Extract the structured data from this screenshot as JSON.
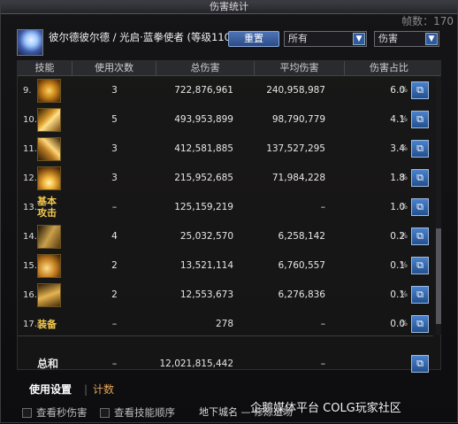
{
  "window": {
    "title": "伤害统计",
    "frame_label": "帧数：170"
  },
  "header": {
    "player_name": "彼尔德彼尔德 / 光启·蓝拳使者 (等级110)",
    "reset_label": "重置",
    "scope_value": "所有",
    "type_value": "伤害"
  },
  "table": {
    "columns": [
      "技能",
      "使用次数",
      "总伤害",
      "平均伤害",
      "伤害占比"
    ],
    "rows": [
      {
        "idx": "9.",
        "icon": "skill-icon",
        "label": "",
        "count": "3",
        "total": "722,876,961",
        "avg": "240,958,987",
        "pct": "6.0",
        "unit": "%"
      },
      {
        "idx": "10.",
        "icon": "skill-icon",
        "label": "",
        "count": "5",
        "total": "493,953,899",
        "avg": "98,790,779",
        "pct": "4.1",
        "unit": "%"
      },
      {
        "idx": "11.",
        "icon": "skill-icon",
        "label": "",
        "count": "3",
        "total": "412,581,885",
        "avg": "137,527,295",
        "pct": "3.4",
        "unit": "%"
      },
      {
        "idx": "12.",
        "icon": "skill-icon",
        "label": "",
        "count": "3",
        "total": "215,952,685",
        "avg": "71,984,228",
        "pct": "1.8",
        "unit": "%"
      },
      {
        "idx": "13.",
        "icon": "text",
        "label": "基本攻击",
        "count": "–",
        "total": "125,159,219",
        "avg": "–",
        "pct": "1.0",
        "unit": "%"
      },
      {
        "idx": "14.",
        "icon": "skill-icon",
        "label": "",
        "count": "4",
        "total": "25,032,570",
        "avg": "6,258,142",
        "pct": "0.2",
        "unit": "%"
      },
      {
        "idx": "15.",
        "icon": "skill-icon",
        "label": "",
        "count": "2",
        "total": "13,521,114",
        "avg": "6,760,557",
        "pct": "0.1",
        "unit": "%"
      },
      {
        "idx": "16.",
        "icon": "skill-icon",
        "label": "",
        "count": "2",
        "total": "12,553,673",
        "avg": "6,276,836",
        "pct": "0.1",
        "unit": "%"
      },
      {
        "idx": "17.",
        "icon": "text",
        "label": "装备",
        "count": "–",
        "total": "278",
        "avg": "–",
        "pct": "0.0",
        "unit": "%"
      }
    ],
    "summary": {
      "label": "总和",
      "count": "–",
      "total": "12,021,815,442",
      "avg": "–"
    },
    "export_glyph": "⧉"
  },
  "tabs": {
    "active": "使用设置",
    "separator": "|",
    "inactive": "计数"
  },
  "footer": {
    "check_dps_label": "查看秒伤害",
    "check_order_label": "查看技能顺序",
    "location_text": "地下城名 — 修炼道场",
    "watermark": "企鹅媒体平台 COLG玩家社区"
  },
  "colors": {
    "accent": "#2f5a9e",
    "gold": "#f2c94c",
    "tab_inactive": "#e6a65a"
  }
}
